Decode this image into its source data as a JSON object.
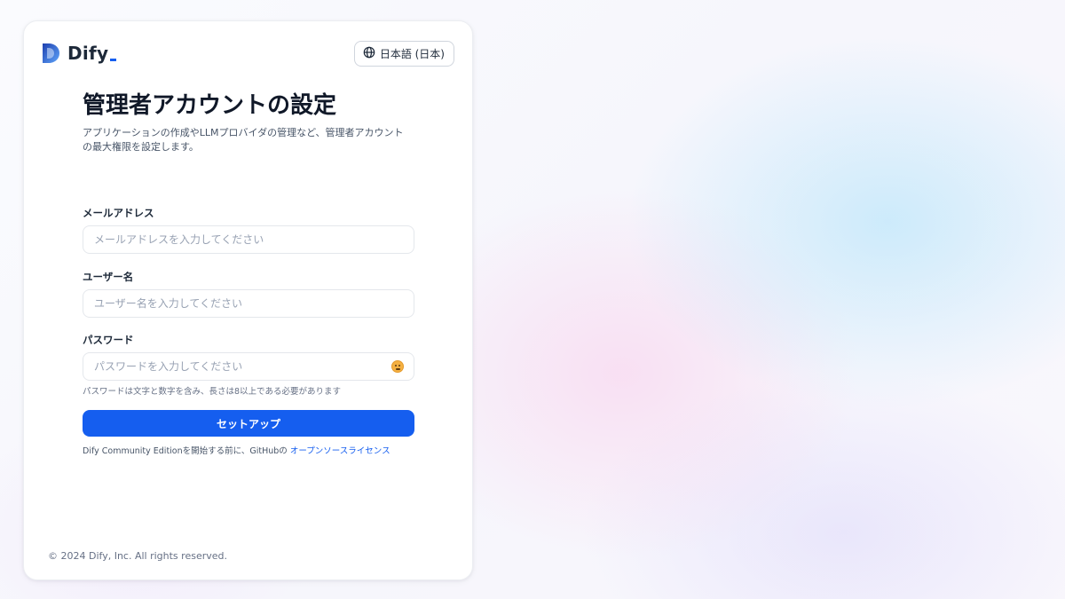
{
  "brand": {
    "name": "Dify"
  },
  "language": {
    "label": "日本語 (日本)"
  },
  "page": {
    "title": "管理者アカウントの設定",
    "subtitle": "アプリケーションの作成やLLMプロバイダの管理など、管理者アカウントの最大権限を設定します。"
  },
  "form": {
    "email": {
      "label": "メールアドレス",
      "placeholder": "メールアドレスを入力してください",
      "value": ""
    },
    "username": {
      "label": "ユーザー名",
      "placeholder": "ユーザー名を入力してください",
      "value": ""
    },
    "password": {
      "label": "パスワード",
      "placeholder": "パスワードを入力してください",
      "value": "",
      "hint": "パスワードは文字と数字を含み、長さは8以上である必要があります"
    },
    "submit_label": "セットアップ"
  },
  "license": {
    "prefix": "Dify Community Editionを開始する前に、GitHubの",
    "link_text": "オープンソースライセンス"
  },
  "footer": {
    "copyright": "© 2024 Dify, Inc. All rights reserved."
  },
  "colors": {
    "accent": "#155eef",
    "text": "#101828",
    "muted": "#667085"
  },
  "icons": {
    "language": "globe-icon",
    "password_toggle": "eye-toggle-icon"
  }
}
